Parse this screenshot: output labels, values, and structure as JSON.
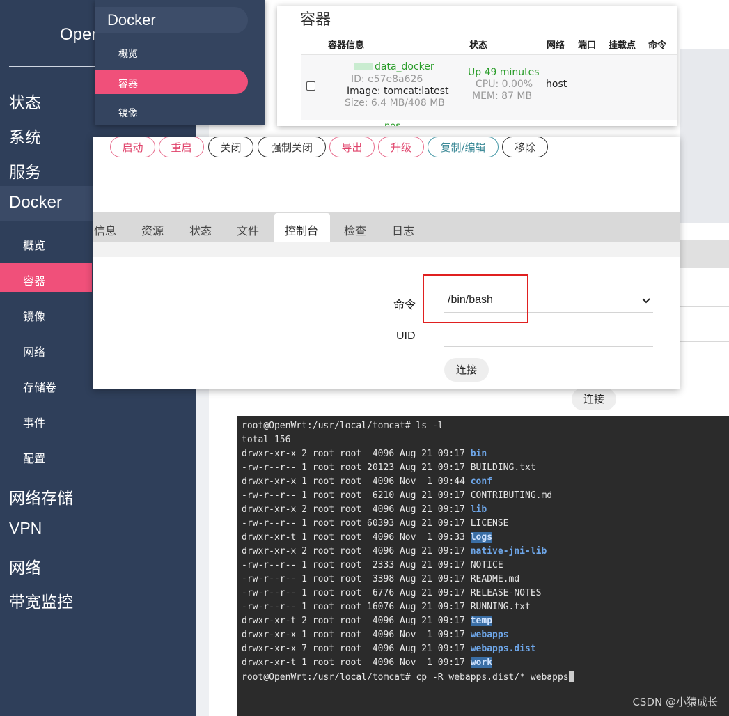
{
  "sidebar": {
    "brand": "Oper",
    "main_items": [
      "状态",
      "系统",
      "服务",
      "Docker",
      "网络存储",
      "VPN",
      "网络",
      "带宽监控"
    ],
    "sub_items": [
      "概览",
      "容器",
      "镜像",
      "网络",
      "存储卷",
      "事件",
      "配置"
    ],
    "active_sub": "容器"
  },
  "docker_menu": {
    "title": "Docker",
    "items": [
      "概览",
      "容器",
      "镜像"
    ],
    "active": "容器"
  },
  "container_table": {
    "title": "容器",
    "headers": [
      "容器信息",
      "状态",
      "网络",
      "端口",
      "挂载点",
      "命令"
    ],
    "row": {
      "name": "data_docker",
      "id": "ID: e57e8a626",
      "image": "Image: tomcat:latest",
      "size": "Size: 6.4 MB/408 MB",
      "status_up": "Up 49 minutes",
      "cpu": "CPU: 0.00%",
      "mem": "MEM: 87 MB",
      "network": "host"
    },
    "next_row_partial": "nos"
  },
  "actions": {
    "buttons": [
      {
        "label": "启动",
        "style": "pink"
      },
      {
        "label": "重启",
        "style": "pink"
      },
      {
        "label": "关闭",
        "style": "dark"
      },
      {
        "label": "强制关闭",
        "style": "dark"
      },
      {
        "label": "导出",
        "style": "pink"
      },
      {
        "label": "升级",
        "style": "pink"
      },
      {
        "label": "复制/编辑",
        "style": "teal"
      },
      {
        "label": "移除",
        "style": "dark"
      }
    ]
  },
  "tabs": {
    "items": [
      "信息",
      "资源",
      "状态",
      "文件",
      "控制台",
      "检查",
      "日志"
    ],
    "active": "控制台"
  },
  "console_form": {
    "command_label": "命令",
    "command_value": "/bin/bash",
    "uid_label": "UID",
    "uid_value": "",
    "connect_label": "连接"
  },
  "background_connect_label": "连接",
  "terminal": {
    "lines": [
      {
        "pre": "root@OpenWrt:/usr/local/tomcat# ls -l"
      },
      {
        "pre": "total 156"
      },
      {
        "pre": "drwxr-xr-x 2 root root  4096 Aug 21 09:17 ",
        "name": "bin",
        "kind": "dir"
      },
      {
        "pre": "-rw-r--r-- 1 root root 20123 Aug 21 09:17 BUILDING.txt"
      },
      {
        "pre": "drwxr-xr-x 1 root root  4096 Nov  1 09:44 ",
        "name": "conf",
        "kind": "dir"
      },
      {
        "pre": "-rw-r--r-- 1 root root  6210 Aug 21 09:17 CONTRIBUTING.md"
      },
      {
        "pre": "drwxr-xr-x 2 root root  4096 Aug 21 09:17 ",
        "name": "lib",
        "kind": "dir"
      },
      {
        "pre": "-rw-r--r-- 1 root root 60393 Aug 21 09:17 LICENSE"
      },
      {
        "pre": "drwxr-xr-t 1 root root  4096 Nov  1 09:33 ",
        "name": "logs",
        "kind": "hl"
      },
      {
        "pre": "drwxr-xr-x 2 root root  4096 Aug 21 09:17 ",
        "name": "native-jni-lib",
        "kind": "dir"
      },
      {
        "pre": "-rw-r--r-- 1 root root  2333 Aug 21 09:17 NOTICE"
      },
      {
        "pre": "-rw-r--r-- 1 root root  3398 Aug 21 09:17 README.md"
      },
      {
        "pre": "-rw-r--r-- 1 root root  6776 Aug 21 09:17 RELEASE-NOTES"
      },
      {
        "pre": "-rw-r--r-- 1 root root 16076 Aug 21 09:17 RUNNING.txt"
      },
      {
        "pre": "drwxr-xr-t 2 root root  4096 Aug 21 09:17 ",
        "name": "temp",
        "kind": "hl"
      },
      {
        "pre": "drwxr-xr-x 1 root root  4096 Nov  1 09:17 ",
        "name": "webapps",
        "kind": "dir"
      },
      {
        "pre": "drwxr-xr-x 7 root root  4096 Aug 21 09:17 ",
        "name": "webapps.dist",
        "kind": "dir"
      },
      {
        "pre": "drwxr-xr-t 1 root root  4096 Nov  1 09:17 ",
        "name": "work",
        "kind": "hl"
      },
      {
        "pre": "root@OpenWrt:/usr/local/tomcat# cp -R webapps.dist/* webapps",
        "cursor": true
      }
    ]
  },
  "watermark": "CSDN @小猿成长"
}
